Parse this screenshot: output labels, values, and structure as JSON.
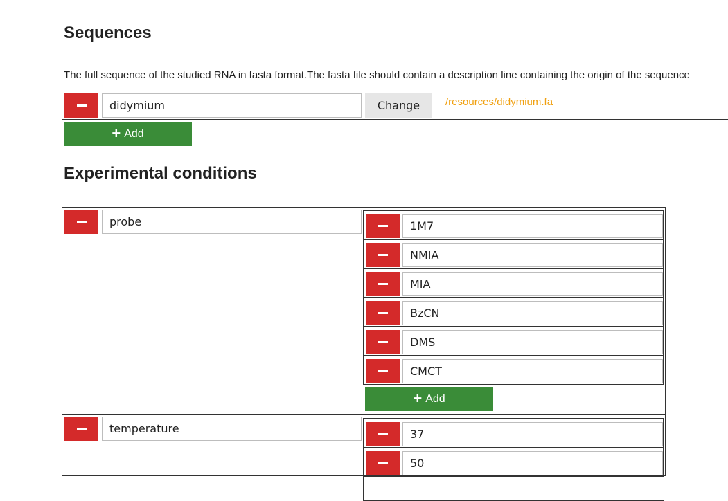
{
  "sequences": {
    "title": "Sequences",
    "description": "The full sequence of the studied RNA in fasta format.The fasta file should contain a description line containing the origin of the sequence",
    "items": [
      {
        "name": "didymium",
        "change_label": "Change",
        "file_link": "/resources/didymium.fa"
      }
    ],
    "add_label": "Add"
  },
  "conditions": {
    "title": "Experimental conditions",
    "items": [
      {
        "name": "probe",
        "values": [
          "1M7",
          "NMIA",
          "MIA",
          "BzCN",
          "DMS",
          "CMCT"
        ],
        "add_label": "Add"
      },
      {
        "name": "temperature",
        "values": [
          "37",
          "50"
        ]
      }
    ]
  },
  "colors": {
    "remove": "#d42a2a",
    "add": "#3a8c38",
    "link": "#f0a010"
  },
  "icons": {
    "remove": "minus-icon",
    "add": "plus-icon"
  }
}
